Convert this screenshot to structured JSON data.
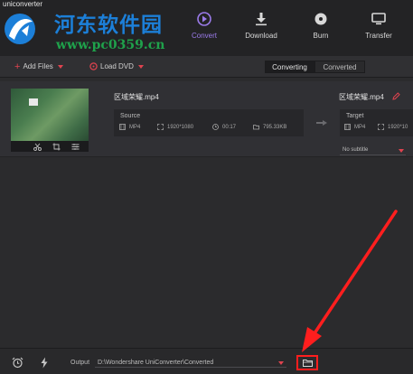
{
  "app": {
    "title": "uniconverter"
  },
  "watermark": {
    "name": "河东软件园",
    "url": "www.pc0359.cn"
  },
  "topnav": [
    {
      "label": "Convert",
      "icon": "convert-icon",
      "active": true
    },
    {
      "label": "Download",
      "icon": "download-icon",
      "active": false
    },
    {
      "label": "Burn",
      "icon": "burn-icon",
      "active": false
    },
    {
      "label": "Transfer",
      "icon": "transfer-icon",
      "active": false
    }
  ],
  "toolbar": {
    "add_files": "Add Files",
    "load_dvd": "Load DVD",
    "tabs": {
      "converting": "Converting",
      "converted": "Converted"
    }
  },
  "file": {
    "name": "区域荣耀.mp4",
    "source": {
      "label": "Source",
      "format": "MP4",
      "resolution": "1920*1080",
      "duration": "00:17",
      "size": "795.33KB"
    },
    "target": {
      "name": "区域荣耀.mp4",
      "label": "Target",
      "format": "MP4",
      "resolution": "1920*10"
    },
    "subtitle": "No subtitle"
  },
  "footer": {
    "output_label": "Output",
    "output_path": "D:\\Wondershare UniConverter\\Converted"
  },
  "colors": {
    "accent": "#9b7bea",
    "red": "#e0434f",
    "highlight": "#ff1e1e",
    "watermark_blue": "#1c7fd8",
    "watermark_green": "#1fa14b"
  }
}
